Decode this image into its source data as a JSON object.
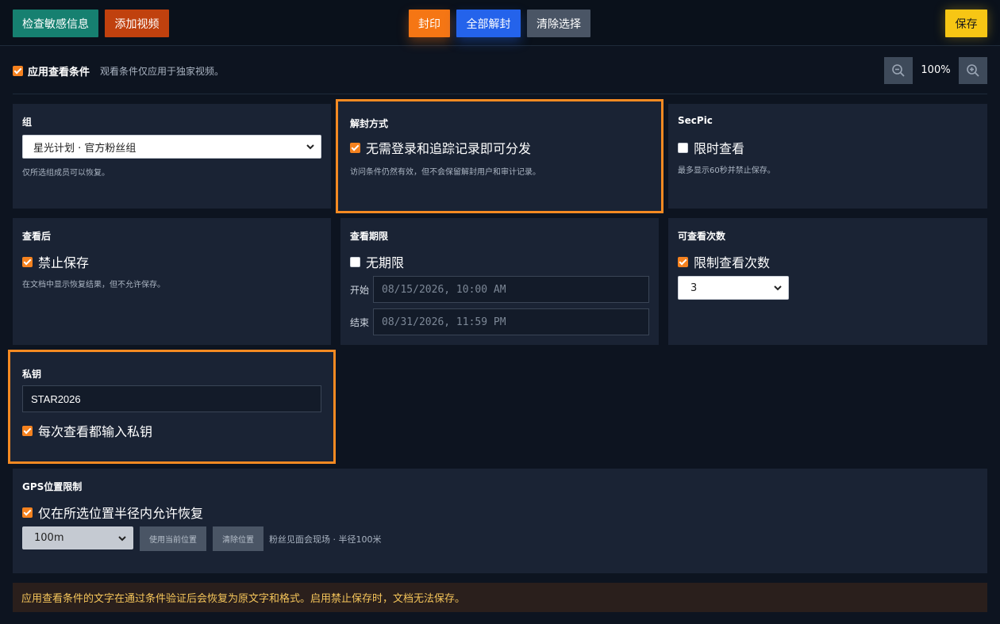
{
  "toolbar": {
    "check_sensitive": "检查敏感信息",
    "add_video": "添加视频",
    "seal": "封印",
    "unseal_all": "全部解封",
    "clear_selection": "清除选择",
    "save": "保存"
  },
  "options": {
    "apply_label": "应用查看条件",
    "apply_checked": true,
    "apply_note": "观看条件仅应用于独家视频。",
    "zoom": "100%"
  },
  "group": {
    "title": "组",
    "selected": "星光计划 · 官方粉丝组",
    "note": "仅所选组成员可以恢复。"
  },
  "unseal_method": {
    "title": "解封方式",
    "option_label": "无需登录和追踪记录即可分发",
    "checked": true,
    "note": "访问条件仍然有效，但不会保留解封用户和审计记录。"
  },
  "secpic": {
    "title": "SecPic",
    "option_label": "限时查看",
    "checked": false,
    "note": "最多显示60秒并禁止保存。"
  },
  "after_view": {
    "title": "查看后",
    "option_label": "禁止保存",
    "checked": true,
    "note": "在文档中显示恢复结果，但不允许保存。"
  },
  "view_period": {
    "title": "查看期限",
    "option_label": "无期限",
    "checked": false,
    "start_label": "开始",
    "start_value": "08/15/2026, 10:00 AM",
    "end_label": "结束",
    "end_value": "08/31/2026, 11:59 PM"
  },
  "view_count": {
    "title": "可查看次数",
    "option_label": "限制查看次数",
    "checked": true,
    "selected": "3"
  },
  "private_key": {
    "title": "私钥",
    "value": "STAR2026",
    "option_label": "每次查看都输入私钥",
    "checked": true
  },
  "gps": {
    "title": "GPS位置限制",
    "option_label": "仅在所选位置半径内允许恢复",
    "checked": true,
    "radius": "100m",
    "use_current": "使用当前位置",
    "clear_location": "清除位置",
    "location_text": "粉丝见面会现场 · 半径100米"
  },
  "footer_note": "应用查看条件的文字在通过条件验证后会恢复为原文字和格式。启用禁止保存时，文档无法保存。",
  "colors": {
    "accent": "#f5821f",
    "highlight_border": "#f58a22",
    "card_bg": "#1a2334",
    "page_bg": "#0d1420"
  }
}
